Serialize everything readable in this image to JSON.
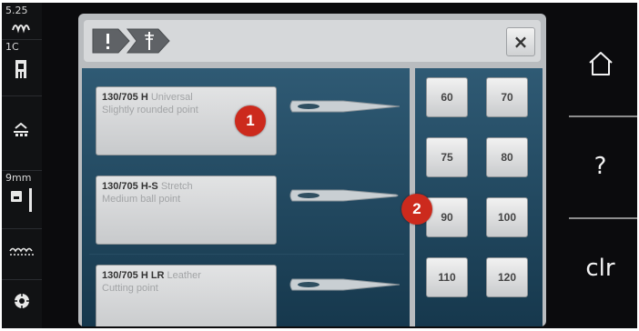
{
  "status_bar": {
    "stitch_length": "5.25",
    "position": "1C",
    "needle_size": "9mm",
    "icons": [
      "stitch-length-icon",
      "presser-foot-icon",
      "feed-dog-icon",
      "needle-plate-icon",
      "stitch-plate-icon",
      "bobbin-icon"
    ]
  },
  "header": {
    "crumbs": [
      "exclamation-icon",
      "needle-icon"
    ],
    "close_label": "×"
  },
  "needles": [
    {
      "code": "130/705 H",
      "type": "Universal",
      "description": "Slightly rounded point",
      "selected": false
    },
    {
      "code": "130/705 H-S",
      "type": "Stretch",
      "description": "Medium ball point",
      "selected": false
    },
    {
      "code": "130/705 H LR",
      "type": "Leather",
      "description": "Cutting point",
      "selected": false
    }
  ],
  "sizes": [
    "60",
    "70",
    "75",
    "80",
    "90",
    "100",
    "110",
    "120"
  ],
  "callouts": [
    "1",
    "2"
  ],
  "nav": {
    "home": "home-icon",
    "help_label": "?",
    "clear_label": "clr"
  },
  "colors": {
    "panel_blue_top": "#2f5a74",
    "panel_blue_bottom": "#16384d",
    "callout_red": "#cc2a1d",
    "screen_black": "#0b0b0d"
  }
}
